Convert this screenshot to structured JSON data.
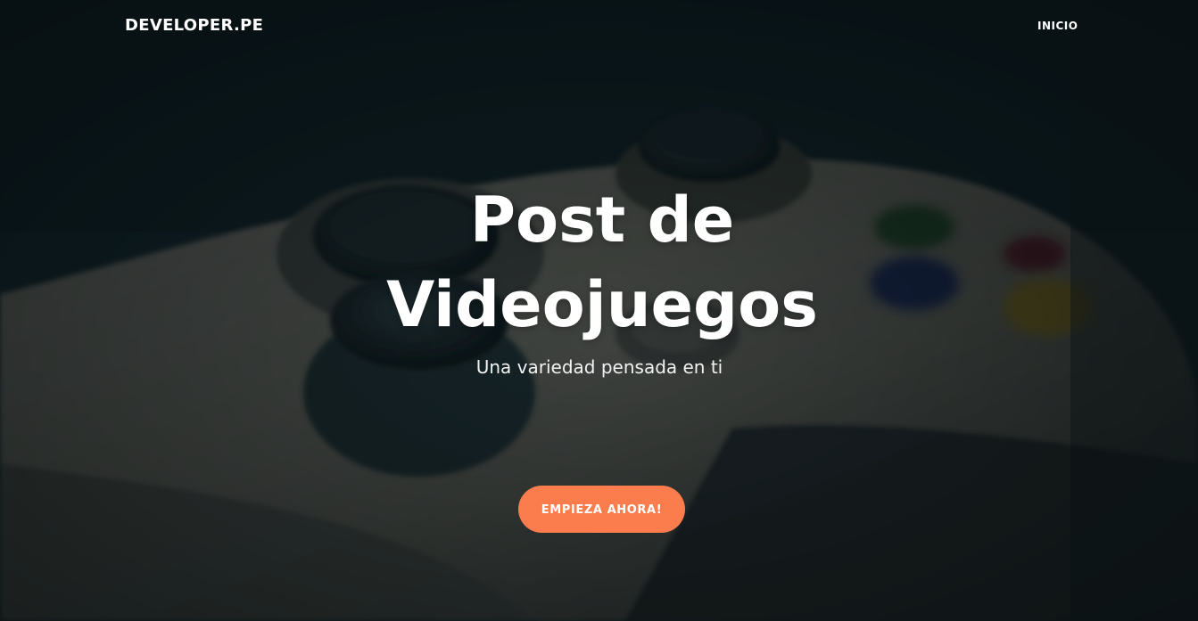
{
  "navbar": {
    "brand": "DEVELOPER.PE",
    "links": [
      {
        "label": "INICIO"
      }
    ]
  },
  "hero": {
    "title_line1": "Post de",
    "title_line2": "Videojuegos",
    "subtitle": "Una variedad pensada en ti",
    "cta_label": "EMPIEZA AHORA!"
  },
  "colors": {
    "accent": "#fb7d4e",
    "overlay": "#0d1a1f",
    "text": "#ffffff"
  },
  "background_image": "gamepad-controller-photo"
}
